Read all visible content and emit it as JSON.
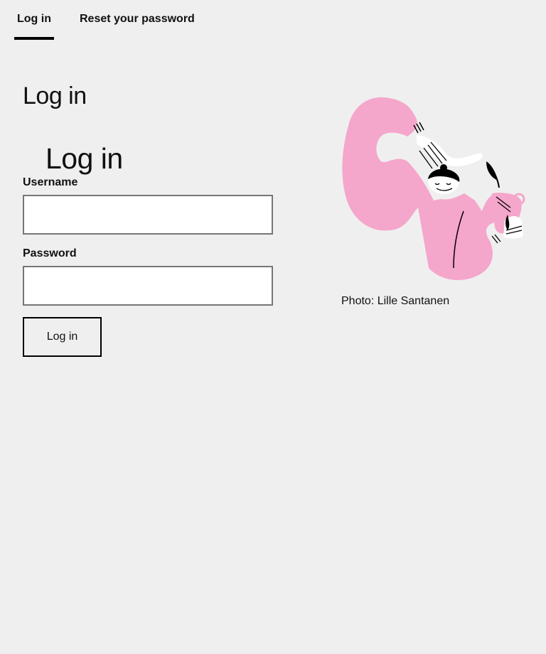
{
  "tabs": [
    {
      "label": "Log in",
      "active": true
    },
    {
      "label": "Reset your password",
      "active": false
    }
  ],
  "page_title": "Log in",
  "form": {
    "title": "Log in",
    "username_label": "Username",
    "username_value": "",
    "password_label": "Password",
    "password_value": "",
    "submit_label": "Log in"
  },
  "illustration": {
    "caption": "Photo: Lille Santanen",
    "accent_color": "#f5a6cb",
    "icon": "pink-figure-illustration"
  },
  "colors": {
    "background": "#efefef",
    "text": "#111111",
    "input_border": "#767676"
  }
}
